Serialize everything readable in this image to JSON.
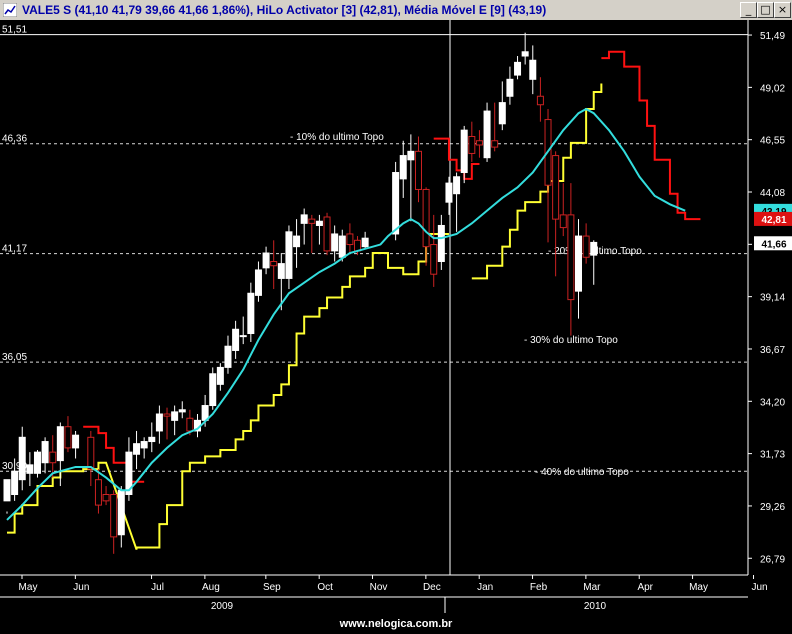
{
  "window": {
    "title": "VALE5 S (41,10  41,79  39,66  41,66  1,86%), HiLo Activator [3] (42,81), Média Móvel E [9] (43,19)",
    "buttons": [
      "_",
      "□",
      "×"
    ]
  },
  "footer": {
    "text": "www.nelogica.com.br"
  },
  "chart_data": {
    "type": "candlestick",
    "y_range": [
      26.0,
      52.2
    ],
    "y_ticks": [
      51.49,
      49.02,
      46.55,
      44.08,
      41.61,
      39.14,
      36.67,
      34.2,
      31.73,
      29.26,
      26.79
    ],
    "y_tick_labels": [
      "51,49",
      "49,02",
      "46,55",
      "44,08",
      "",
      "39,14",
      "36,67",
      "34,20",
      "31,73",
      "29,26",
      "26,79"
    ],
    "last_price_label": "41,66",
    "hilo_label": "42,81",
    "ema_label": "43,19",
    "x_month_labels": [
      "May",
      "Jun",
      "Jul",
      "Aug",
      "Sep",
      "Oct",
      "Nov",
      "Dec",
      "Jan",
      "Feb",
      "Mar",
      "Apr",
      "May",
      "Jun"
    ],
    "x_month_positions": [
      0,
      7,
      17,
      24,
      32,
      39,
      46,
      53,
      60,
      67,
      74,
      81,
      88,
      96
    ],
    "year_labels": [
      {
        "label": "2009",
        "start": 0,
        "end": 59
      },
      {
        "label": "2010",
        "start": 60,
        "end": 98
      }
    ],
    "candles": [
      [
        29.5,
        30.5,
        29.0,
        28.9
      ],
      [
        29.8,
        30.9,
        31.5,
        29.5
      ],
      [
        30.5,
        32.5,
        33.0,
        30.0
      ],
      [
        30.8,
        31.2,
        31.8,
        30.2
      ],
      [
        30.8,
        31.8,
        31.9,
        30.6
      ],
      [
        31.3,
        32.3,
        32.5,
        30.8
      ],
      [
        31.8,
        31.3,
        32.6,
        30.6
      ],
      [
        31.4,
        33.0,
        33.2,
        30.2
      ],
      [
        33.0,
        32.0,
        33.5,
        31.8
      ],
      [
        32.0,
        32.6,
        32.8,
        31.5
      ],
      [
        32.5,
        31.0,
        32.8,
        30.2
      ],
      [
        30.5,
        29.3,
        31.0,
        28.9
      ],
      [
        29.8,
        29.5,
        30.2,
        29.3
      ],
      [
        29.8,
        27.8,
        30.0,
        27.0
      ],
      [
        27.9,
        30.0,
        30.2,
        27.3
      ],
      [
        29.8,
        31.8,
        32.5,
        29.5
      ],
      [
        31.7,
        32.2,
        32.8,
        31.0
      ],
      [
        32.0,
        32.3,
        32.5,
        31.5
      ],
      [
        32.3,
        32.5,
        33.2,
        31.8
      ],
      [
        32.8,
        33.6,
        34.0,
        32.2
      ],
      [
        33.6,
        33.5,
        33.9,
        32.4
      ],
      [
        33.3,
        33.7,
        34.0,
        32.6
      ],
      [
        33.7,
        33.8,
        34.2,
        33.4
      ],
      [
        33.4,
        32.8,
        33.8,
        32.6
      ],
      [
        32.8,
        33.3,
        33.6,
        32.5
      ],
      [
        33.3,
        34.0,
        34.5,
        33.0
      ],
      [
        34.0,
        35.5,
        35.8,
        33.8
      ],
      [
        35.0,
        35.8,
        36.0,
        34.7
      ],
      [
        35.8,
        36.8,
        37.3,
        35.5
      ],
      [
        36.6,
        37.6,
        38.0,
        36.2
      ],
      [
        37.3,
        37.3,
        38.2,
        36.9
      ],
      [
        37.4,
        39.3,
        39.8,
        37.0
      ],
      [
        39.2,
        40.4,
        40.8,
        38.9
      ],
      [
        40.5,
        41.2,
        41.5,
        40.2
      ],
      [
        40.8,
        40.6,
        41.8,
        39.5
      ],
      [
        40.0,
        40.7,
        41.2,
        38.5
      ],
      [
        40.0,
        42.2,
        42.5,
        39.5
      ],
      [
        41.5,
        42.0,
        42.8,
        40.5
      ],
      [
        42.6,
        43.0,
        43.3,
        41.6
      ],
      [
        42.8,
        42.6,
        43.0,
        41.2
      ],
      [
        42.5,
        42.7,
        43.0,
        41.6
      ],
      [
        42.9,
        41.3,
        43.1,
        41.1
      ],
      [
        41.3,
        42.1,
        42.5,
        40.8
      ],
      [
        41.0,
        42.0,
        42.3,
        40.8
      ],
      [
        42.1,
        41.6,
        42.6,
        41.2
      ],
      [
        41.8,
        41.3,
        42.0,
        41.1
      ],
      [
        41.5,
        41.9,
        42.2,
        41.4
      ],
      [
        42.1,
        45.0,
        45.5,
        41.8
      ],
      [
        44.7,
        45.8,
        46.5,
        43.8
      ],
      [
        45.6,
        46.0,
        46.8,
        42.7
      ],
      [
        46.0,
        44.2,
        46.7,
        43.6
      ],
      [
        44.2,
        41.5,
        44.3,
        40.6
      ],
      [
        41.6,
        40.2,
        43.0,
        39.6
      ],
      [
        40.8,
        42.5,
        43.0,
        40.4
      ],
      [
        43.6,
        44.5,
        44.8,
        43.0
      ],
      [
        44.0,
        44.8,
        45.0,
        42.2
      ],
      [
        45.0,
        47.0,
        47.2,
        44.5
      ],
      [
        46.7,
        45.9,
        47.4,
        45.5
      ],
      [
        46.5,
        46.3,
        47.0,
        45.7
      ],
      [
        45.7,
        47.9,
        48.3,
        45.5
      ],
      [
        46.5,
        46.2,
        48.3,
        46.0
      ],
      [
        47.3,
        48.3,
        49.3,
        47.0
      ],
      [
        48.6,
        49.4,
        50.0,
        48.2
      ],
      [
        49.6,
        50.2,
        50.5,
        49.4
      ],
      [
        50.5,
        50.7,
        51.6,
        50.1
      ],
      [
        49.4,
        50.3,
        51.0,
        48.7
      ],
      [
        48.6,
        48.2,
        49.5,
        47.4
      ],
      [
        47.5,
        44.4,
        48.0,
        41.7
      ],
      [
        45.8,
        42.8,
        46.0,
        40.1
      ],
      [
        43.0,
        42.4,
        44.5,
        42.0
      ],
      [
        43.0,
        39.0,
        44.5,
        37.3
      ],
      [
        39.4,
        42.0,
        42.8,
        38.1
      ],
      [
        42.0,
        41.0,
        42.6,
        40.7
      ],
      [
        41.1,
        41.7,
        41.8,
        39.7
      ]
    ],
    "candle_x": [
      0,
      1,
      2,
      3,
      4,
      5,
      6,
      7,
      8,
      9,
      11,
      12,
      13,
      14,
      15,
      16,
      17,
      18,
      19,
      20,
      21,
      22,
      23,
      24,
      25,
      26,
      27,
      28,
      29,
      30,
      31,
      32,
      33,
      34,
      35,
      36,
      37,
      38,
      39,
      40,
      41,
      42,
      43,
      44,
      45,
      46,
      47,
      51,
      52,
      53,
      54,
      55,
      56,
      57,
      58,
      59,
      60,
      61,
      62,
      63,
      64,
      65,
      66,
      67,
      68,
      69,
      70,
      71,
      72,
      73,
      74,
      75,
      76,
      77
    ],
    "ema": [
      [
        0,
        28.6
      ],
      [
        2,
        29.3
      ],
      [
        4,
        30.1
      ],
      [
        6,
        30.8
      ],
      [
        9,
        31.1
      ],
      [
        11,
        31.1
      ],
      [
        13,
        30.6
      ],
      [
        15,
        30.0
      ],
      [
        16,
        30.0
      ],
      [
        17,
        30.4
      ],
      [
        19,
        31.3
      ],
      [
        21,
        32.0
      ],
      [
        23,
        32.6
      ],
      [
        25,
        32.9
      ],
      [
        27,
        33.6
      ],
      [
        29,
        34.6
      ],
      [
        31,
        35.7
      ],
      [
        33,
        37.1
      ],
      [
        35,
        38.3
      ],
      [
        37,
        39.3
      ],
      [
        39,
        39.8
      ],
      [
        41,
        40.3
      ],
      [
        43,
        40.7
      ],
      [
        45,
        41.2
      ],
      [
        47,
        41.4
      ],
      [
        49,
        41.6
      ],
      [
        50,
        42.0
      ],
      [
        52,
        42.6
      ],
      [
        53,
        42.8
      ],
      [
        54,
        42.6
      ],
      [
        55,
        42.2
      ],
      [
        56,
        41.9
      ],
      [
        57,
        41.9
      ],
      [
        59,
        42.1
      ],
      [
        61,
        42.6
      ],
      [
        63,
        43.2
      ],
      [
        65,
        43.8
      ],
      [
        67,
        44.3
      ],
      [
        69,
        45.0
      ],
      [
        71,
        46.0
      ],
      [
        73,
        47.0
      ],
      [
        75,
        47.8
      ],
      [
        76,
        48.0
      ],
      [
        77,
        47.8
      ],
      [
        79,
        47.0
      ],
      [
        81,
        46.0
      ],
      [
        83,
        44.8
      ],
      [
        85,
        43.9
      ],
      [
        87,
        43.5
      ],
      [
        89,
        43.2
      ]
    ],
    "hilo_support": [
      [
        0,
        28.0
      ],
      [
        1,
        28.0
      ],
      [
        1,
        28.9
      ],
      [
        2,
        28.9
      ],
      [
        2,
        29.3
      ],
      [
        4,
        29.3
      ],
      [
        4,
        30.2
      ],
      [
        6,
        30.2
      ],
      [
        6,
        30.6
      ],
      [
        7,
        30.6
      ],
      [
        7,
        30.9
      ],
      [
        10,
        30.9
      ],
      [
        10,
        31.0
      ],
      [
        12,
        31.0
      ],
      [
        12,
        31.3
      ],
      [
        13,
        31.3
      ],
      [
        17,
        27.2
      ],
      [
        17,
        27.3
      ],
      [
        20,
        27.3
      ],
      [
        20,
        28.4
      ],
      [
        21,
        28.4
      ],
      [
        21,
        29.3
      ],
      [
        23,
        29.3
      ],
      [
        23,
        30.9
      ],
      [
        24,
        30.9
      ],
      [
        24,
        31.3
      ],
      [
        26,
        31.3
      ],
      [
        26,
        31.6
      ],
      [
        28,
        31.6
      ],
      [
        28,
        31.9
      ],
      [
        30,
        31.9
      ],
      [
        30,
        32.4
      ],
      [
        31,
        32.4
      ],
      [
        31,
        32.8
      ],
      [
        32,
        32.8
      ],
      [
        32,
        33.3
      ],
      [
        33,
        33.3
      ],
      [
        33,
        34.0
      ],
      [
        35,
        34.0
      ],
      [
        35,
        34.5
      ],
      [
        36,
        34.5
      ],
      [
        36,
        35.0
      ],
      [
        37,
        35.0
      ],
      [
        37,
        35.9
      ],
      [
        38,
        35.9
      ],
      [
        38,
        37.4
      ],
      [
        39,
        37.4
      ],
      [
        39,
        38.2
      ],
      [
        41,
        38.2
      ],
      [
        41,
        38.6
      ],
      [
        42,
        38.6
      ],
      [
        42,
        39.1
      ],
      [
        44,
        39.1
      ],
      [
        44,
        39.6
      ],
      [
        45,
        39.6
      ],
      [
        45,
        40.1
      ],
      [
        47,
        40.1
      ],
      [
        47,
        40.5
      ],
      [
        48,
        40.5
      ],
      [
        48,
        41.2
      ],
      [
        50,
        41.2
      ],
      [
        50,
        40.5
      ],
      [
        52,
        40.5
      ],
      [
        52,
        40.2
      ],
      [
        54,
        40.2
      ],
      [
        54,
        40.8
      ],
      [
        55,
        40.8
      ],
      [
        55,
        42.1
      ],
      [
        57,
        42.1
      ],
      [
        58,
        42.1
      ]
    ],
    "hilo_support2": [
      [
        61,
        40.0
      ],
      [
        63,
        40.0
      ],
      [
        63,
        40.6
      ],
      [
        65,
        40.6
      ],
      [
        65,
        41.5
      ],
      [
        66,
        41.5
      ],
      [
        66,
        42.3
      ],
      [
        67,
        42.3
      ],
      [
        67,
        43.2
      ],
      [
        68,
        43.2
      ],
      [
        68,
        43.6
      ],
      [
        70,
        43.6
      ],
      [
        70,
        44.1
      ],
      [
        71,
        44.1
      ],
      [
        71,
        44.6
      ],
      [
        73,
        44.6
      ],
      [
        73,
        45.7
      ],
      [
        74,
        45.7
      ],
      [
        74,
        46.4
      ],
      [
        76,
        46.4
      ],
      [
        76,
        48.0
      ],
      [
        77,
        48.0
      ],
      [
        77,
        48.8
      ],
      [
        78,
        48.8
      ],
      [
        78,
        49.2
      ]
    ],
    "hilo_resist": [
      [
        10,
        33.0
      ],
      [
        12,
        33.0
      ],
      [
        12,
        32.7
      ],
      [
        13,
        32.7
      ],
      [
        13,
        32.0
      ],
      [
        14,
        32.0
      ],
      [
        14,
        31.3
      ],
      [
        16,
        31.3
      ],
      [
        16,
        30.4
      ],
      [
        18,
        30.4
      ]
    ],
    "hilo_resist2": [
      [
        56,
        46.6
      ],
      [
        58,
        46.6
      ],
      [
        58,
        45.6
      ],
      [
        59,
        45.6
      ],
      [
        59,
        45.1
      ],
      [
        60,
        45.1
      ],
      [
        60,
        44.7
      ],
      [
        61,
        44.7
      ],
      [
        61,
        45.4
      ],
      [
        62,
        45.4
      ]
    ],
    "hilo_resist3": [
      [
        78,
        50.4
      ],
      [
        79,
        50.4
      ],
      [
        79,
        50.7
      ],
      [
        81,
        50.7
      ],
      [
        81,
        50.0
      ],
      [
        83,
        50.0
      ],
      [
        83,
        48.4
      ],
      [
        84,
        48.4
      ],
      [
        84,
        47.2
      ],
      [
        85,
        47.2
      ],
      [
        85,
        45.6
      ],
      [
        87,
        45.6
      ],
      [
        87,
        44.0
      ],
      [
        88,
        44.0
      ],
      [
        88,
        43.1
      ],
      [
        89,
        43.1
      ],
      [
        89,
        42.8
      ],
      [
        91,
        42.8
      ]
    ],
    "levels": [
      {
        "value": 51.51,
        "label": "51,51",
        "style": "solid"
      },
      {
        "value": 46.36,
        "label": "46,36",
        "note": "- 10% do ultimo Topo",
        "style": "dash"
      },
      {
        "value": 41.17,
        "label": "41,17",
        "note": "- 20% do ultimo Topo",
        "style": "dash"
      },
      {
        "value": 36.05,
        "label": "36,05",
        "note": "- 30% do ultimo Topo",
        "style": "dash"
      },
      {
        "value": 30.9,
        "label": "30,90",
        "note": "- 40% do ultimo Topo",
        "style": "dash"
      }
    ],
    "colors": {
      "background": "#000000",
      "up_candle": "#ffffff",
      "down_candle": "#cc2222",
      "ema": "#33dddd",
      "hilo_support": "#ffff33",
      "hilo_resist": "#ff1111",
      "grid": "#ffffff",
      "label_bg_price": "#ffffff",
      "label_bg_hilo": "#dd1111",
      "label_bg_ema": "#33dddd"
    }
  }
}
